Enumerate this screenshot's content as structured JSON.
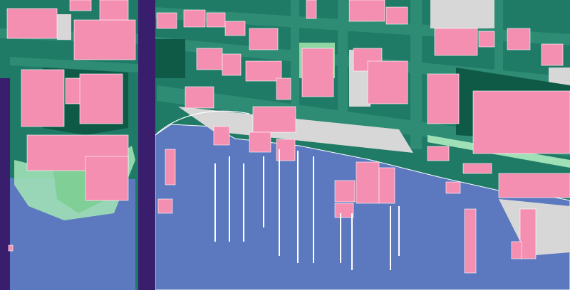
{
  "map": {
    "kind": "stylized waterfront city map",
    "labels": [],
    "colors": {
      "water": "#5c79bf",
      "land_base": "#1f7a66",
      "road": "#2e8b74",
      "building": "#f48fb1",
      "paved": "#d7d7d7",
      "park": "#9fe0b6",
      "dark_green": "#0f5a46",
      "divider": "#3a1e6e",
      "outline": "#ffffff"
    }
  }
}
